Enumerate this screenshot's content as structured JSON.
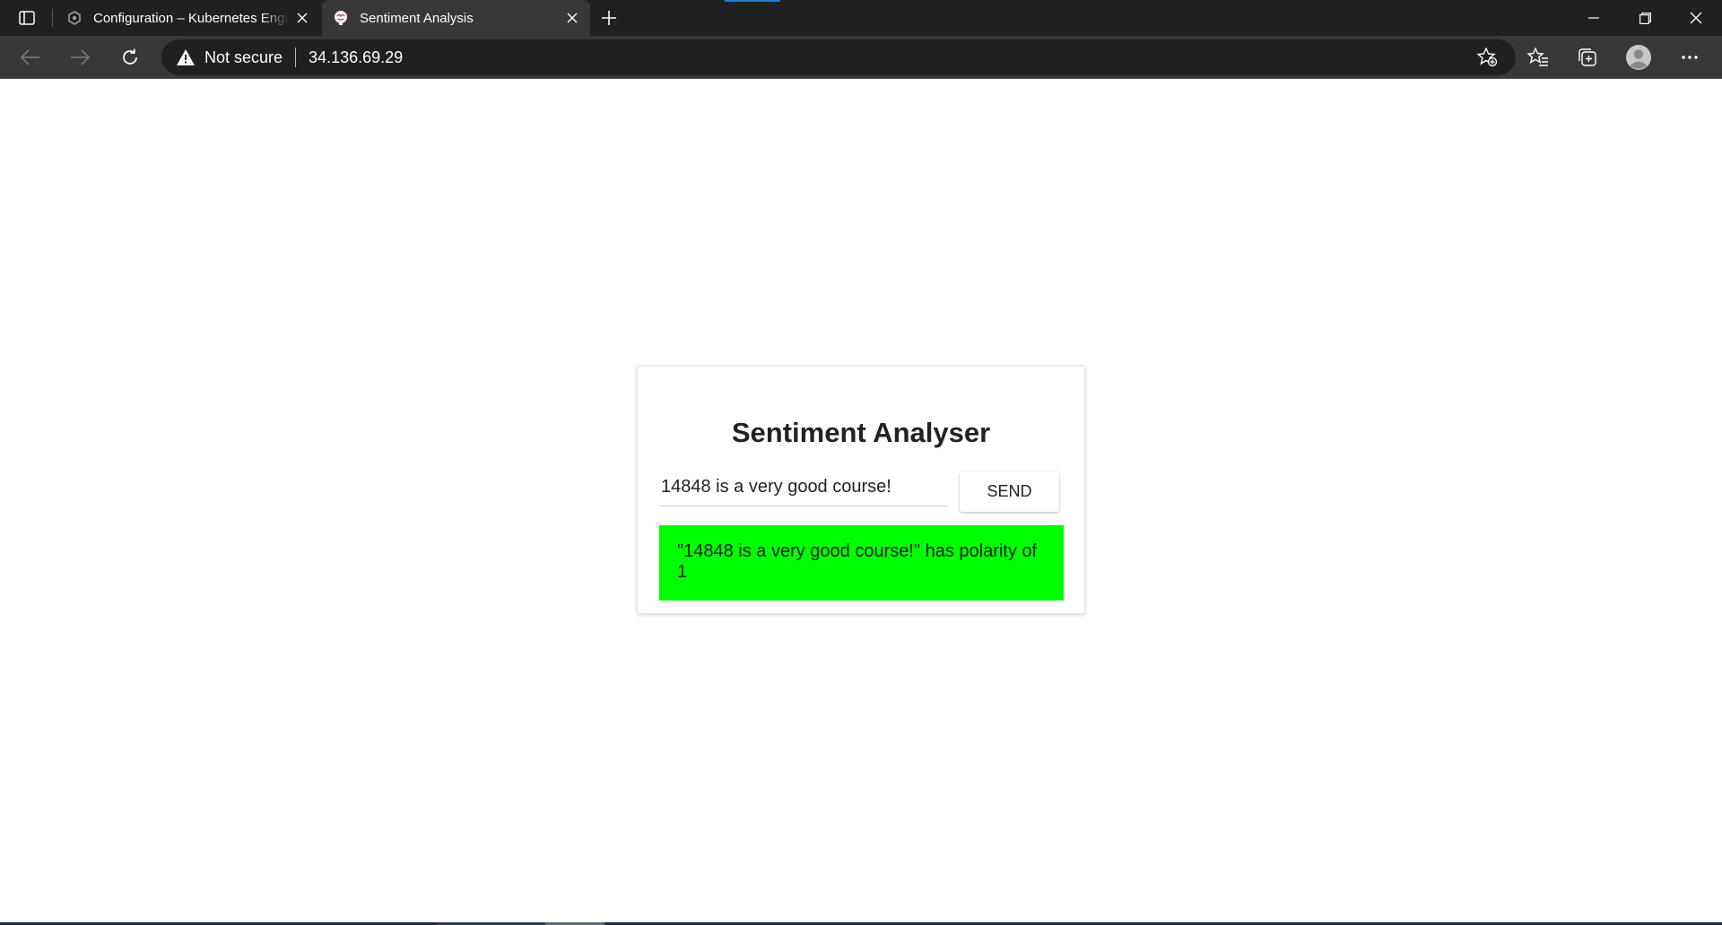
{
  "browser": {
    "tabs": [
      {
        "title": "Configuration – Kubernetes Engi",
        "favicon": "google-cloud-icon",
        "active": false
      },
      {
        "title": "Sentiment Analysis",
        "favicon": "brain-icon",
        "active": true
      }
    ],
    "address": {
      "security_label": "Not secure",
      "url": "34.136.69.29"
    }
  },
  "app": {
    "title": "Sentiment Analyser",
    "input_value": "14848 is a very good course!",
    "send_label": "SEND",
    "result_text": "\"14848 is a very good course!\" has polarity of 1",
    "result_color": "#00ff00"
  },
  "colors": {
    "tabstrip_bg": "#202020",
    "toolbar_bg": "#383838",
    "accent": "#2b78d4"
  }
}
